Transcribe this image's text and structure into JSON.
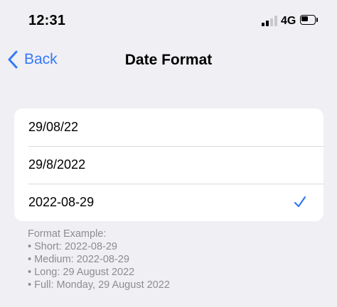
{
  "status_bar": {
    "time": "12:31",
    "network": "4G",
    "signal_bars": 2,
    "battery_level": 0.35
  },
  "nav": {
    "back_label": "Back",
    "title": "Date Format"
  },
  "options": [
    {
      "label": "29/08/22",
      "selected": false
    },
    {
      "label": "29/8/2022",
      "selected": false
    },
    {
      "label": "2022-08-29",
      "selected": true
    }
  ],
  "example": {
    "heading": "Format Example:",
    "lines": [
      "• Short: 2022-08-29",
      "• Medium: 2022-08-29",
      "• Long: 29 August 2022",
      "• Full: Monday, 29 August 2022"
    ]
  },
  "colors": {
    "accent": "#3479f6",
    "background": "#f0eff4",
    "card": "#ffffff",
    "secondary_text": "#8c8c91"
  }
}
